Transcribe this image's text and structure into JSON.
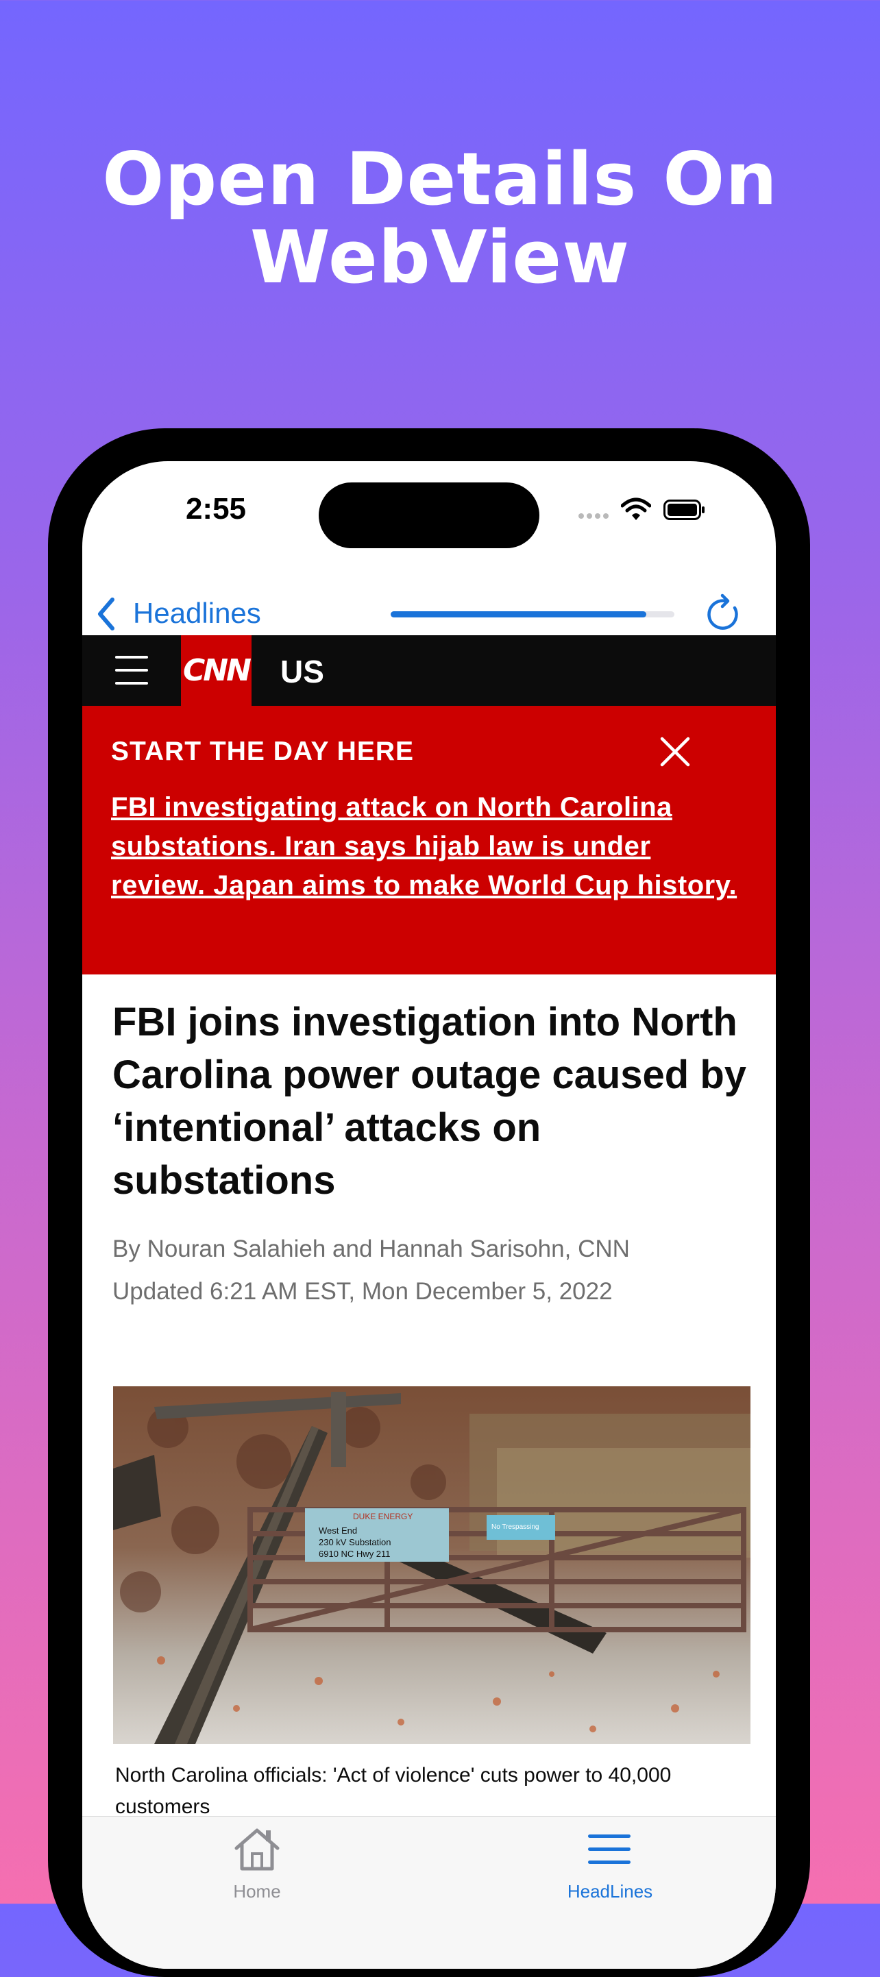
{
  "promo": {
    "title_line1": "Open Details On",
    "title_line2": "WebView"
  },
  "status_bar": {
    "time": "2:55"
  },
  "nav": {
    "back_label": "Headlines",
    "load_progress": 0.9
  },
  "cnn_header": {
    "logo": "CNN",
    "section": "US"
  },
  "banner": {
    "heading": "START THE DAY HERE",
    "link_text": "FBI investigating attack on North Carolina substations. Iran says hijab law is under review. Japan aims to make World Cup history."
  },
  "article": {
    "headline": "FBI joins investigation into North Carolina power outage caused by ‘intentional’ attacks on substations",
    "byline": "By Nouran Salahieh and Hannah Sarisohn, CNN",
    "updated": "Updated 6:21 AM EST, Mon December 5, 2022",
    "photo_sign_brand": "DUKE ENERGY",
    "photo_sign_line1": "West End",
    "photo_sign_line2": "230 kV Substation",
    "photo_sign_line3": "6910 NC Hwy 211",
    "photo_sign_small": "No Trespassing",
    "caption": "North Carolina officials: 'Act of violence' cuts power to 40,000 customers"
  },
  "tabs": {
    "home_label": "Home",
    "headlines_label": "HeadLines"
  },
  "colors": {
    "accent": "#1a73d9",
    "cnn_red": "#cc0000",
    "header_black": "#0c0c0c"
  }
}
